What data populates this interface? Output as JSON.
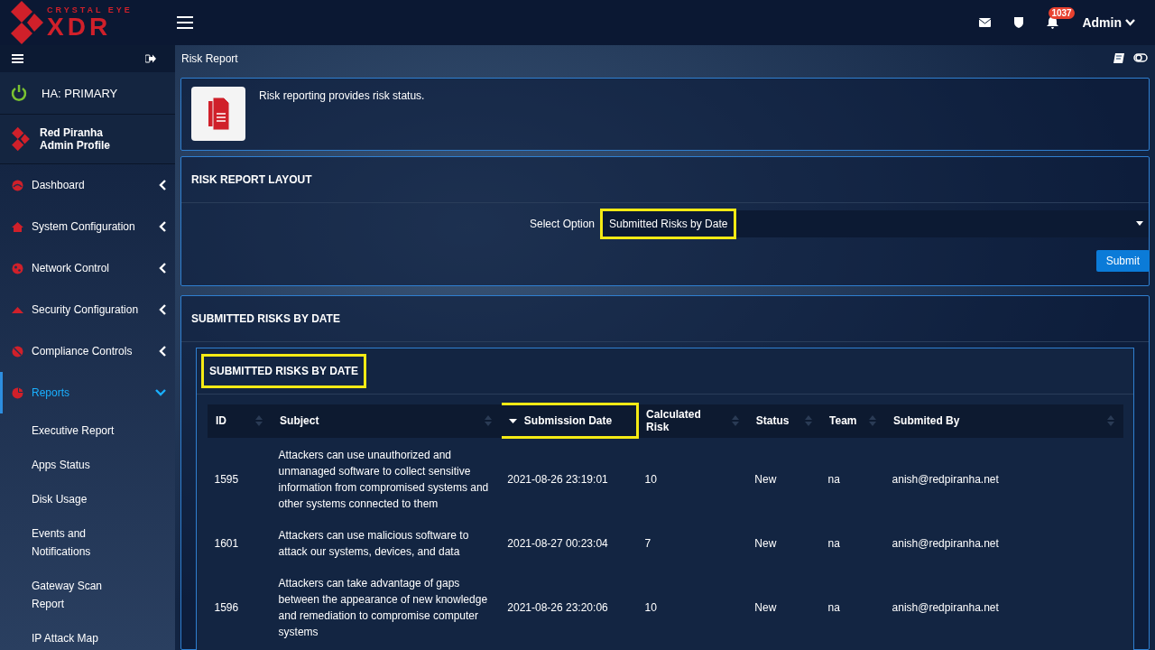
{
  "brand": {
    "tagline": "CRYSTAL EYE",
    "name": "XDR"
  },
  "topbar": {
    "notification_count": "1037",
    "user": "Admin"
  },
  "sidebar": {
    "ha_status": "HA: PRIMARY",
    "profile": {
      "name": "Red Piranha",
      "role": "Admin Profile"
    },
    "items": [
      {
        "label": "Dashboard",
        "expanded": false,
        "selected": false
      },
      {
        "label": "System Configuration",
        "expanded": false,
        "selected": false
      },
      {
        "label": "Network Control",
        "expanded": false,
        "selected": false
      },
      {
        "label": "Security Configuration",
        "expanded": false,
        "selected": false
      },
      {
        "label": "Compliance Controls",
        "expanded": false,
        "selected": false
      },
      {
        "label": "Reports",
        "expanded": true,
        "selected": true,
        "children": [
          {
            "label": "Executive Report"
          },
          {
            "label": "Apps Status"
          },
          {
            "label": "Disk Usage"
          },
          {
            "label": "Events and Notifications"
          },
          {
            "label": "Gateway Scan Report"
          },
          {
            "label": "IP Attack Map"
          }
        ]
      }
    ]
  },
  "page": {
    "title": "Risk Report",
    "description": "Risk reporting provides risk status."
  },
  "layout_panel": {
    "title": "RISK REPORT LAYOUT",
    "select_label": "Select Option",
    "select_value": "Submitted Risks by Date",
    "select_highlighted": true,
    "submit": "Submit"
  },
  "results_panel": {
    "title": "SUBMITTED RISKS BY DATE",
    "table_title": "SUBMITTED RISKS BY DATE",
    "table_title_highlighted": true,
    "columns": [
      {
        "label": "ID",
        "sorted": false,
        "highlighted": false
      },
      {
        "label": "Subject",
        "sorted": false,
        "highlighted": false
      },
      {
        "label": "Submission Date",
        "sorted": true,
        "highlighted": true
      },
      {
        "label": "Calculated Risk",
        "sorted": false,
        "highlighted": false
      },
      {
        "label": "Status",
        "sorted": false,
        "highlighted": false
      },
      {
        "label": "Team",
        "sorted": false,
        "highlighted": false
      },
      {
        "label": "Submited By",
        "sorted": false,
        "highlighted": false
      }
    ],
    "rows": [
      [
        "1595",
        "Attackers can use unauthorized and unmanaged software to collect sensitive information from compromised systems and other systems connected to them",
        "2021-08-26 23:19:01",
        "10",
        "New",
        "na",
        "anish@redpiranha.net"
      ],
      [
        "1601",
        "Attackers can use malicious software to attack our systems, devices, and data",
        "2021-08-27 00:23:04",
        "7",
        "New",
        "na",
        "anish@redpiranha.net"
      ],
      [
        "1596",
        "Attackers can take advantage of gaps between the appearance of new knowledge and remediation to compromise computer systems",
        "2021-08-26 23:20:06",
        "10",
        "New",
        "na",
        "anish@redpiranha.net"
      ]
    ]
  }
}
